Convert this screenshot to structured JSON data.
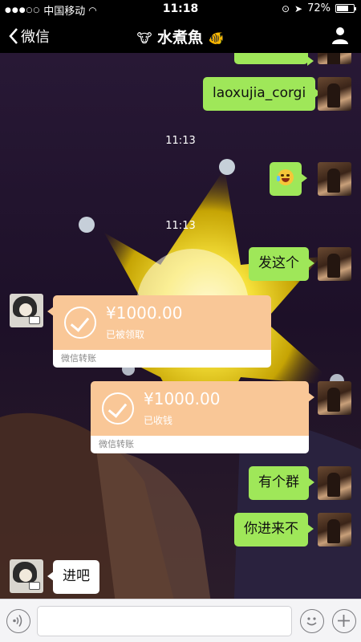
{
  "status_bar": {
    "carrier": "中国移动",
    "time": "11:18",
    "battery": "72%",
    "battery_level": 0.72
  },
  "nav": {
    "back_label": "微信",
    "title": "水煮魚"
  },
  "timestamps": [
    "11:13",
    "11:13"
  ],
  "messages": [
    {
      "from": "self",
      "type": "text",
      "text": "laoxujia_corgi"
    },
    {
      "from": "self",
      "type": "emoji",
      "icon": "laughing-crying-emoji-icon"
    },
    {
      "from": "self",
      "type": "text",
      "text": "发这个"
    },
    {
      "from": "other",
      "type": "transfer",
      "amount": "¥1000.00",
      "status": "已被领取",
      "footer": "微信转账"
    },
    {
      "from": "self",
      "type": "transfer",
      "amount": "¥1000.00",
      "status": "已收钱",
      "footer": "微信转账"
    },
    {
      "from": "self",
      "type": "text",
      "text": "有个群"
    },
    {
      "from": "self",
      "type": "text",
      "text": "你进来不"
    },
    {
      "from": "other",
      "type": "text",
      "text": "进吧"
    }
  ],
  "input_bar": {
    "placeholder": ""
  },
  "colors": {
    "self_bubble": "#9fe759",
    "other_bubble": "#ffffff",
    "transfer_card": "#f9c797",
    "nav_background": "#000000"
  }
}
